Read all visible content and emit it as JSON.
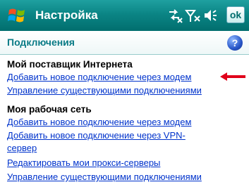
{
  "titlebar": {
    "title": "Настройка",
    "ok_label": "ok",
    "icons": [
      "windows-start-icon",
      "connectivity-icon",
      "signal-strength-icon",
      "volume-icon"
    ]
  },
  "header": {
    "title": "Подключения",
    "help_label": "?"
  },
  "groups": [
    {
      "title": "Мой поставщик Интернета",
      "links": [
        "Добавить новое подключение через модем",
        "Управление существующими подключениями"
      ]
    },
    {
      "title": "Моя рабочая сеть",
      "links": [
        "Добавить новое подключение через модем",
        "Добавить новое подключение через VPN-",
        "сервер",
        "Редактировать мои прокси-серверы",
        "Управление существующими подключениями"
      ]
    }
  ],
  "colors": {
    "titlebar": "#0b8585",
    "link": "#0033cc",
    "section_title": "#0a7b86",
    "arrow": "#e0001a"
  }
}
